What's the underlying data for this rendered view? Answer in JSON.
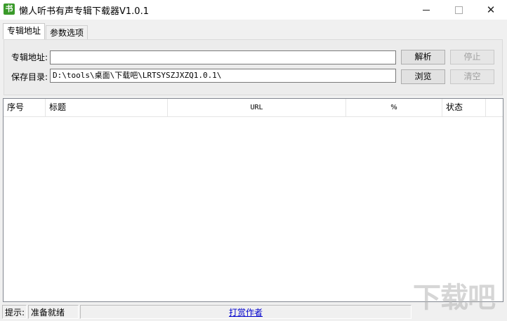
{
  "window": {
    "title": "懒人听书有声专辑下载器V1.0.1",
    "app_icon_glyph": "书",
    "minimize_glyph": "—",
    "close_glyph": "✕"
  },
  "tabs": [
    {
      "label": "专辑地址",
      "active": true
    },
    {
      "label": "参数选项",
      "active": false
    }
  ],
  "form": {
    "album_label": "专辑地址:",
    "album_value": "",
    "save_label": "保存目录:",
    "save_value": "D:\\tools\\桌面\\下载吧\\LRTSYSZJXZQ1.0.1\\"
  },
  "buttons": {
    "parse": "解析",
    "stop": "停止",
    "browse": "浏览",
    "clear": "清空"
  },
  "table": {
    "columns": [
      "序号",
      "标题",
      "URL",
      "%",
      "状态"
    ],
    "rows": []
  },
  "statusbar": {
    "hint_label": "提示:",
    "status_text": "准备就绪",
    "donate_link": "打赏作者"
  },
  "watermark": {
    "text": "下载吧"
  },
  "colors": {
    "app_icon": "#3a9a2a",
    "link": "#0000cc",
    "disabled_text": "#a0a0a0"
  }
}
